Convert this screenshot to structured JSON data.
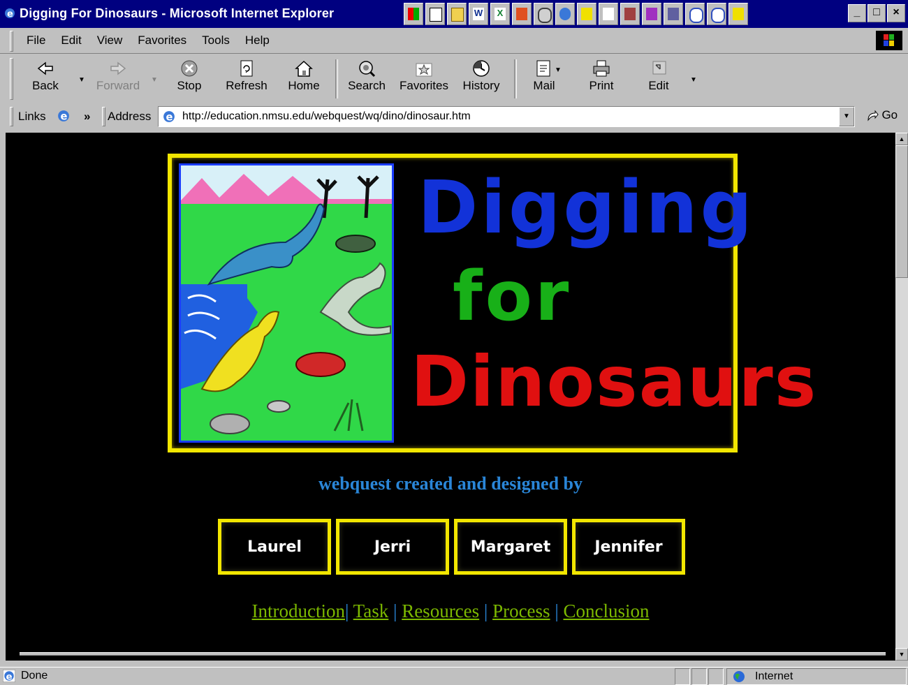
{
  "window": {
    "title": "Digging For Dinosaurs - Microsoft Internet Explorer",
    "buttons": {
      "minimize": "_",
      "maximize": "□",
      "close": "×"
    }
  },
  "menu": [
    "File",
    "Edit",
    "View",
    "Favorites",
    "Tools",
    "Help"
  ],
  "toolbar": {
    "back": "Back",
    "forward": "Forward",
    "stop": "Stop",
    "refresh": "Refresh",
    "home": "Home",
    "search": "Search",
    "favorites": "Favorites",
    "history": "History",
    "mail": "Mail",
    "print": "Print",
    "edit": "Edit"
  },
  "address": {
    "links_label": "Links",
    "chevron": "»",
    "label": "Address",
    "url": "http://education.nmsu.edu/webquest/wq/dino/dinosaur.htm",
    "go": "Go"
  },
  "page": {
    "banner": {
      "line1": "Digging",
      "line2": "for",
      "line3": "Dinosaurs"
    },
    "credit": "webquest created and designed by",
    "authors": [
      "Laurel",
      "Jerri",
      "Margaret",
      "Jennifer"
    ],
    "nav": [
      "Introduction",
      "Task",
      "Resources",
      "Process",
      "Conclusion"
    ],
    "nav_separator": "|"
  },
  "status": {
    "text": "Done",
    "zone": "Internet"
  },
  "colors": {
    "titlebar": "#000080",
    "banner_border": "#f2e600",
    "credit_text": "#2a86d8",
    "nav_link": "#7cb800"
  }
}
